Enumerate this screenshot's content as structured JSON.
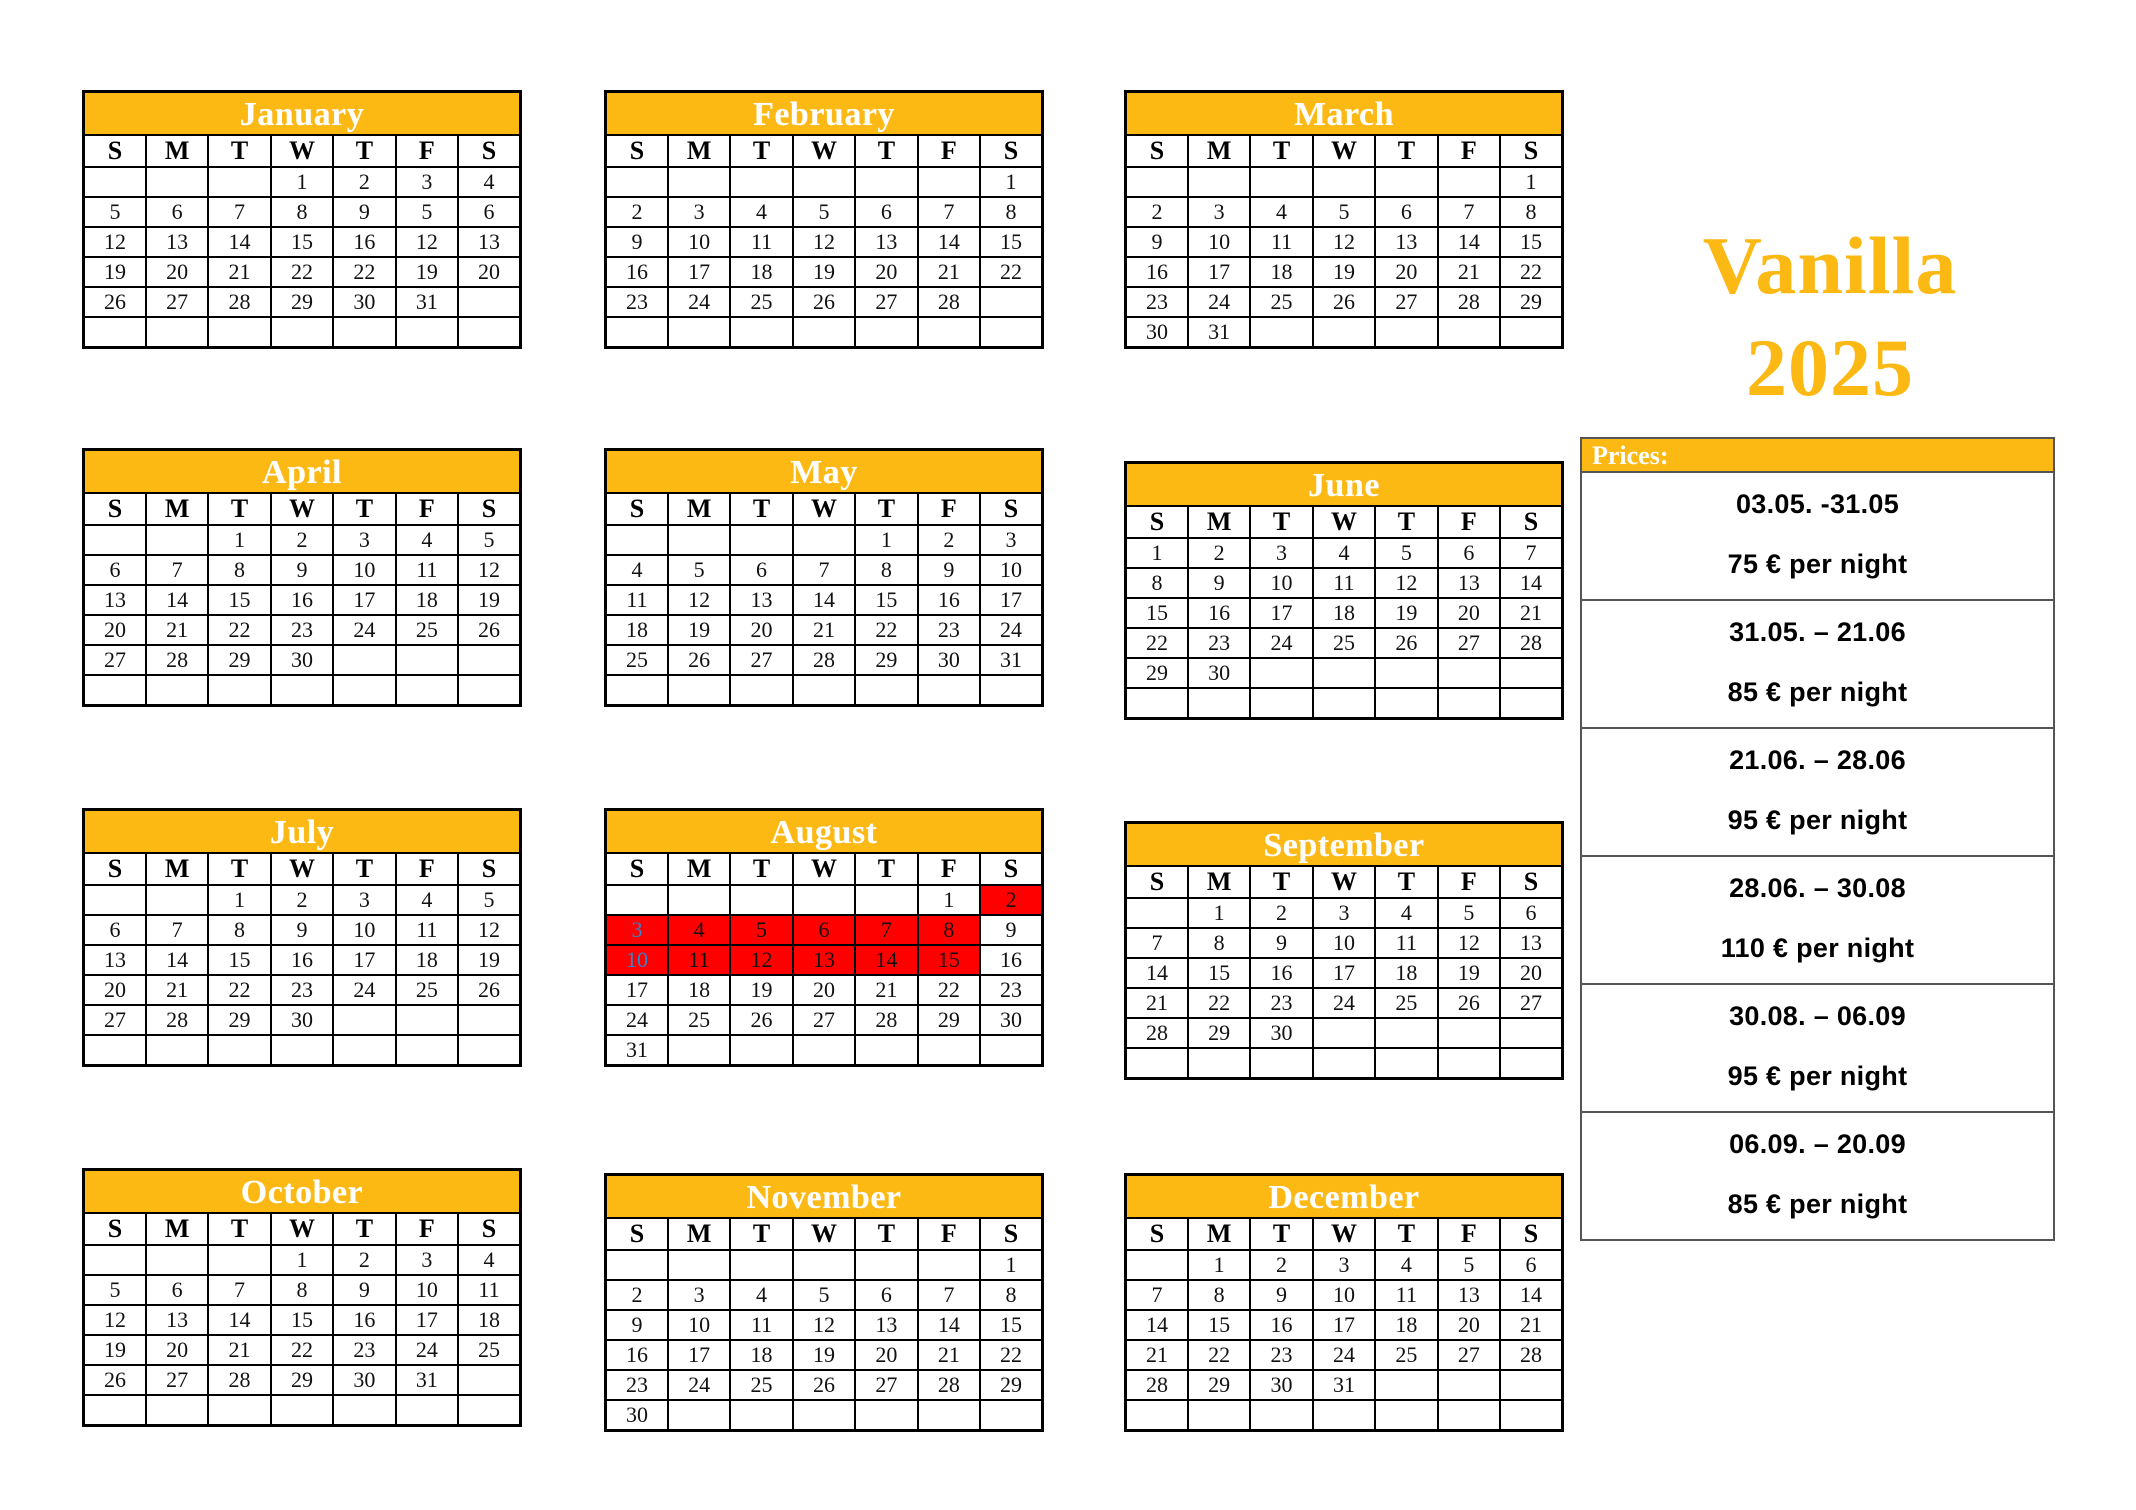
{
  "brand": {
    "name": "Vanilla",
    "year": "2025",
    "color": "#FCB813"
  },
  "theme": {
    "header_bg": "#FCB813",
    "header_text": "#FFFFFF",
    "sunday_text": "#2E86D0",
    "highlight_bg": "#FF0000",
    "grid_line": "#000000",
    "page_bg": "#FFFFFF"
  },
  "weekday_headers": [
    "S",
    "M",
    "T",
    "W",
    "T",
    "F",
    "S"
  ],
  "months": [
    {
      "name": "January",
      "weeks": [
        [
          "",
          "",
          "",
          "1",
          "2",
          "3",
          "4"
        ],
        [
          "5",
          "6",
          "7",
          "8",
          "9",
          "5",
          "6"
        ],
        [
          "12",
          "13",
          "14",
          "15",
          "16",
          "12",
          "13"
        ],
        [
          "19",
          "20",
          "21",
          "22",
          "22",
          "19",
          "20"
        ],
        [
          "26",
          "27",
          "28",
          "29",
          "30",
          "31",
          ""
        ],
        [
          "",
          "",
          "",
          "",
          "",
          "",
          ""
        ]
      ],
      "highlights": []
    },
    {
      "name": "February",
      "weeks": [
        [
          "",
          "",
          "",
          "",
          "",
          "",
          "1"
        ],
        [
          "2",
          "3",
          "4",
          "5",
          "6",
          "7",
          "8"
        ],
        [
          "9",
          "10",
          "11",
          "12",
          "13",
          "14",
          "15"
        ],
        [
          "16",
          "17",
          "18",
          "19",
          "20",
          "21",
          "22"
        ],
        [
          "23",
          "24",
          "25",
          "26",
          "27",
          "28",
          ""
        ],
        [
          "",
          "",
          "",
          "",
          "",
          "",
          ""
        ]
      ],
      "highlights": []
    },
    {
      "name": "March",
      "weeks": [
        [
          "",
          "",
          "",
          "",
          "",
          "",
          "1"
        ],
        [
          "2",
          "3",
          "4",
          "5",
          "6",
          "7",
          "8"
        ],
        [
          "9",
          "10",
          "11",
          "12",
          "13",
          "14",
          "15"
        ],
        [
          "16",
          "17",
          "18",
          "19",
          "20",
          "21",
          "22"
        ],
        [
          "23",
          "24",
          "25",
          "26",
          "27",
          "28",
          "29"
        ],
        [
          "30",
          "31",
          "",
          "",
          "",
          "",
          ""
        ]
      ],
      "highlights": []
    },
    {
      "name": "April",
      "weeks": [
        [
          "",
          "",
          "1",
          "2",
          "3",
          "4",
          "5"
        ],
        [
          "6",
          "7",
          "8",
          "9",
          "10",
          "11",
          "12"
        ],
        [
          "13",
          "14",
          "15",
          "16",
          "17",
          "18",
          "19"
        ],
        [
          "20",
          "21",
          "22",
          "23",
          "24",
          "25",
          "26"
        ],
        [
          "27",
          "28",
          "29",
          "30",
          "",
          "",
          ""
        ],
        [
          "",
          "",
          "",
          "",
          "",
          "",
          ""
        ]
      ],
      "highlights": []
    },
    {
      "name": "May",
      "weeks": [
        [
          "",
          "",
          "",
          "",
          "1",
          "2",
          "3"
        ],
        [
          "4",
          "5",
          "6",
          "7",
          "8",
          "9",
          "10"
        ],
        [
          "11",
          "12",
          "13",
          "14",
          "15",
          "16",
          "17"
        ],
        [
          "18",
          "19",
          "20",
          "21",
          "22",
          "23",
          "24"
        ],
        [
          "25",
          "26",
          "27",
          "28",
          "29",
          "30",
          "31"
        ],
        [
          "",
          "",
          "",
          "",
          "",
          "",
          ""
        ]
      ],
      "highlights": []
    },
    {
      "name": "June",
      "weeks": [
        [
          "1",
          "2",
          "3",
          "4",
          "5",
          "6",
          "7"
        ],
        [
          "8",
          "9",
          "10",
          "11",
          "12",
          "13",
          "14"
        ],
        [
          "15",
          "16",
          "17",
          "18",
          "19",
          "20",
          "21"
        ],
        [
          "22",
          "23",
          "24",
          "25",
          "26",
          "27",
          "28"
        ],
        [
          "29",
          "30",
          "",
          "",
          "",
          "",
          ""
        ],
        [
          "",
          "",
          "",
          "",
          "",
          "",
          ""
        ]
      ],
      "highlights": []
    },
    {
      "name": "July",
      "weeks": [
        [
          "",
          "",
          "1",
          "2",
          "3",
          "4",
          "5"
        ],
        [
          "6",
          "7",
          "8",
          "9",
          "10",
          "11",
          "12"
        ],
        [
          "13",
          "14",
          "15",
          "16",
          "17",
          "18",
          "19"
        ],
        [
          "20",
          "21",
          "22",
          "23",
          "24",
          "25",
          "26"
        ],
        [
          "27",
          "28",
          "29",
          "30",
          "",
          "",
          ""
        ],
        [
          "",
          "",
          "",
          "",
          "",
          "",
          ""
        ]
      ],
      "highlights": []
    },
    {
      "name": "August",
      "weeks": [
        [
          "",
          "",
          "",
          "",
          "",
          "1",
          "2"
        ],
        [
          "3",
          "4",
          "5",
          "6",
          "7",
          "8",
          "9"
        ],
        [
          "10",
          "11",
          "12",
          "13",
          "14",
          "15",
          "16"
        ],
        [
          "17",
          "18",
          "19",
          "20",
          "21",
          "22",
          "23"
        ],
        [
          "24",
          "25",
          "26",
          "27",
          "28",
          "29",
          "30"
        ],
        [
          "31",
          "",
          "",
          "",
          "",
          "",
          ""
        ]
      ],
      "highlights": [
        [
          0,
          6
        ],
        [
          1,
          0
        ],
        [
          1,
          1
        ],
        [
          1,
          2
        ],
        [
          1,
          3
        ],
        [
          1,
          4
        ],
        [
          1,
          5
        ],
        [
          2,
          0
        ],
        [
          2,
          1
        ],
        [
          2,
          2
        ],
        [
          2,
          3
        ],
        [
          2,
          4
        ],
        [
          2,
          5
        ]
      ]
    },
    {
      "name": "September",
      "weeks": [
        [
          "",
          "1",
          "2",
          "3",
          "4",
          "5",
          "6"
        ],
        [
          "7",
          "8",
          "9",
          "10",
          "11",
          "12",
          "13"
        ],
        [
          "14",
          "15",
          "16",
          "17",
          "18",
          "19",
          "20"
        ],
        [
          "21",
          "22",
          "23",
          "24",
          "25",
          "26",
          "27"
        ],
        [
          "28",
          "29",
          "30",
          "",
          "",
          "",
          ""
        ],
        [
          "",
          "",
          "",
          "",
          "",
          "",
          ""
        ]
      ],
      "highlights": []
    },
    {
      "name": "October",
      "weeks": [
        [
          "",
          "",
          "",
          "1",
          "2",
          "3",
          "4"
        ],
        [
          "5",
          "6",
          "7",
          "8",
          "9",
          "10",
          "11"
        ],
        [
          "12",
          "13",
          "14",
          "15",
          "16",
          "17",
          "18"
        ],
        [
          "19",
          "20",
          "21",
          "22",
          "23",
          "24",
          "25"
        ],
        [
          "26",
          "27",
          "28",
          "29",
          "30",
          "31",
          ""
        ],
        [
          "",
          "",
          "",
          "",
          "",
          "",
          ""
        ]
      ],
      "highlights": []
    },
    {
      "name": "November",
      "weeks": [
        [
          "",
          "",
          "",
          "",
          "",
          "",
          "1"
        ],
        [
          "2",
          "3",
          "4",
          "5",
          "6",
          "7",
          "8"
        ],
        [
          "9",
          "10",
          "11",
          "12",
          "13",
          "14",
          "15"
        ],
        [
          "16",
          "17",
          "18",
          "19",
          "20",
          "21",
          "22"
        ],
        [
          "23",
          "24",
          "25",
          "26",
          "27",
          "28",
          "29"
        ],
        [
          "30",
          "",
          "",
          "",
          "",
          "",
          ""
        ]
      ],
      "highlights": []
    },
    {
      "name": "December",
      "weeks": [
        [
          "",
          "1",
          "2",
          "3",
          "4",
          "5",
          "6"
        ],
        [
          "7",
          "8",
          "9",
          "10",
          "11",
          "13",
          "14"
        ],
        [
          "14",
          "15",
          "16",
          "17",
          "18",
          "20",
          "21"
        ],
        [
          "21",
          "22",
          "23",
          "24",
          "25",
          "27",
          "28"
        ],
        [
          "28",
          "29",
          "30",
          "31",
          "",
          "",
          ""
        ],
        [
          "",
          "",
          "",
          "",
          "",
          "",
          ""
        ]
      ],
      "highlights": []
    }
  ],
  "prices": {
    "header": "Prices:",
    "rows": [
      {
        "range": "03.05. -31.05",
        "amount": "75 € per night"
      },
      {
        "range": "31.05. – 21.06",
        "amount": "85 € per night"
      },
      {
        "range": "21.06. – 28.06",
        "amount": "95 € per night"
      },
      {
        "range": "28.06. – 30.08",
        "amount": "110 € per night"
      },
      {
        "range": "30.08. – 06.09",
        "amount": "95 € per night"
      },
      {
        "range": "06.09. – 20.09",
        "amount": "85 € per night"
      }
    ]
  }
}
